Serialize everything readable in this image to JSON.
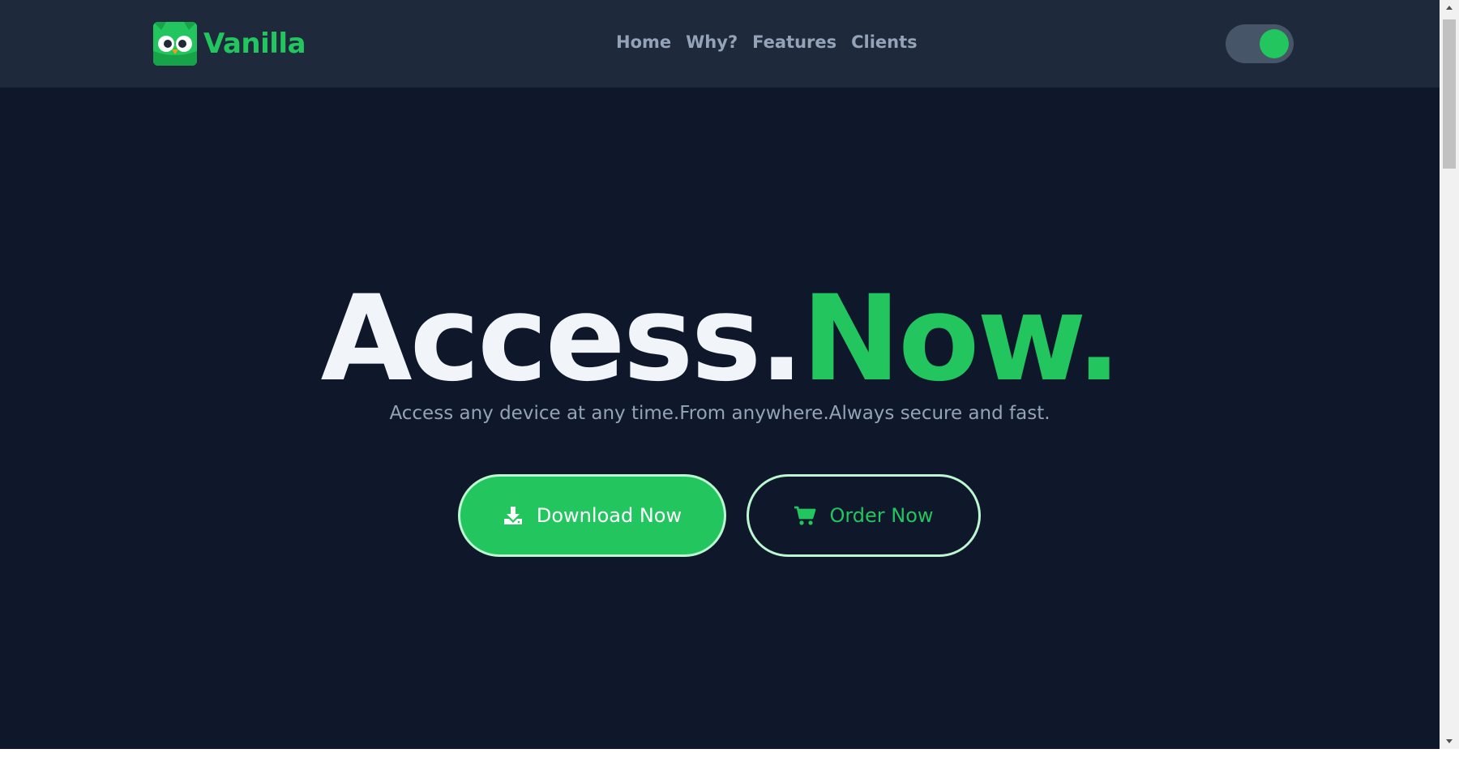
{
  "brand": {
    "name": "Vanilla",
    "logo_icon": "owl-icon"
  },
  "nav": {
    "items": [
      {
        "label": "Home"
      },
      {
        "label": "Why?"
      },
      {
        "label": "Features"
      },
      {
        "label": "Clients"
      }
    ]
  },
  "theme_toggle": {
    "state": "on",
    "accent": "#22c55e"
  },
  "hero": {
    "title_main": "Access.",
    "title_accent": "Now.",
    "subtitle": "Access any device at any time.From anywhere.Always secure and fast."
  },
  "actions": {
    "download": {
      "label": "Download Now",
      "icon": "download-icon"
    },
    "order": {
      "label": "Order Now",
      "icon": "cart-icon"
    }
  },
  "colors": {
    "background": "#0f172a",
    "header": "#1e293b",
    "accent": "#22c55e",
    "nav_text": "#94a3b8",
    "title_text": "#f1f5f9",
    "button_border": "#bbf7d0"
  }
}
